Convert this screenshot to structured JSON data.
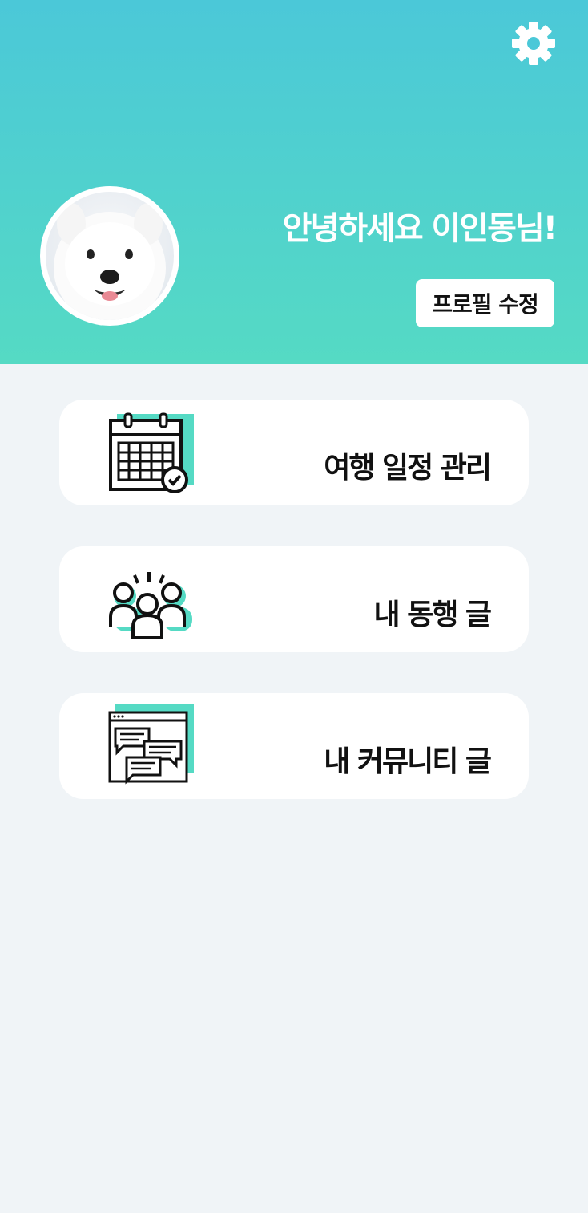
{
  "header": {
    "greeting": "안녕하세요 이인동님!",
    "edit_profile_label": "프로필 수정",
    "settings_icon": "gear-icon",
    "gradient_top": "#4bc8d8",
    "gradient_bottom": "#55dac4"
  },
  "menu": [
    {
      "label": "여행 일정 관리",
      "icon": "calendar-check-icon"
    },
    {
      "label": "내 동행 글",
      "icon": "group-people-icon"
    },
    {
      "label": "내 커뮤니티 글",
      "icon": "chat-window-icon"
    }
  ],
  "accent_color": "#55dac4"
}
